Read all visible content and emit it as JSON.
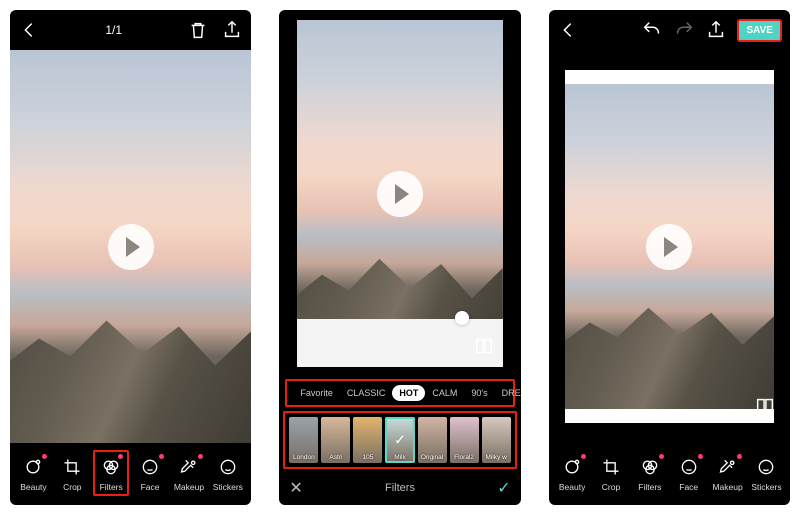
{
  "s1": {
    "counter": "1/1",
    "tools": [
      {
        "label": "Beauty",
        "icon": "sparkle",
        "dot": true
      },
      {
        "label": "Crop",
        "icon": "crop",
        "dot": false
      },
      {
        "label": "Filters",
        "icon": "filters",
        "dot": true
      },
      {
        "label": "Face",
        "icon": "face",
        "dot": true
      },
      {
        "label": "Makeup",
        "icon": "makeup",
        "dot": true
      },
      {
        "label": "Stickers",
        "icon": "sticker",
        "dot": false
      }
    ],
    "highlight_index": 2
  },
  "s2": {
    "categories": [
      "Favorite",
      "CLASSIC",
      "HOT",
      "CALM",
      "90's",
      "DREAMY"
    ],
    "active_category_index": 2,
    "thumbs": [
      {
        "label": "London",
        "tint": "#9aa2ad"
      },
      {
        "label": "Astri",
        "tint": "#d6b89c"
      },
      {
        "label": "105",
        "tint": "#e3b46e"
      },
      {
        "label": "Milk",
        "tint": "#c9dedc"
      },
      {
        "label": "Original",
        "tint": "#d0b4a4"
      },
      {
        "label": "Floral2",
        "tint": "#dfc2cf"
      },
      {
        "label": "Milky w",
        "tint": "#d8c9c0"
      }
    ],
    "selected_thumb_index": 3,
    "title": "Filters"
  },
  "s3": {
    "save_label": "SAVE",
    "tools_ref": "s1.tools"
  }
}
